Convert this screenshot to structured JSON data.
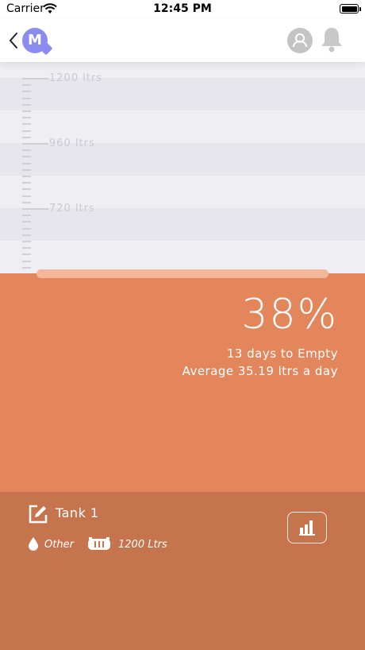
{
  "status_bar": {
    "carrier": "Carrier",
    "time": "12:45 PM"
  },
  "nav": {
    "logo_letter": "M"
  },
  "gauge": {
    "scale_labels": [
      "1200 ltrs",
      "960 ltrs",
      "720 ltrs"
    ],
    "fill_percent": 38
  },
  "tank_status": {
    "percent_text": "38%",
    "days_to_empty": "13 days to Empty",
    "average_usage": "Average 35.19 ltrs a day"
  },
  "tank": {
    "name": "Tank 1",
    "liquid_type": "Other",
    "capacity": "1200 Ltrs"
  },
  "colors": {
    "accent": "#8a8cf0",
    "water": "#e4865c",
    "water_dark": "#c6744e",
    "level_bar": "#f5b79b"
  },
  "icons": [
    "back-chevron-icon",
    "profile-icon",
    "bell-icon",
    "edit-icon",
    "drop-icon",
    "tank-icon",
    "bar-chart-icon"
  ]
}
